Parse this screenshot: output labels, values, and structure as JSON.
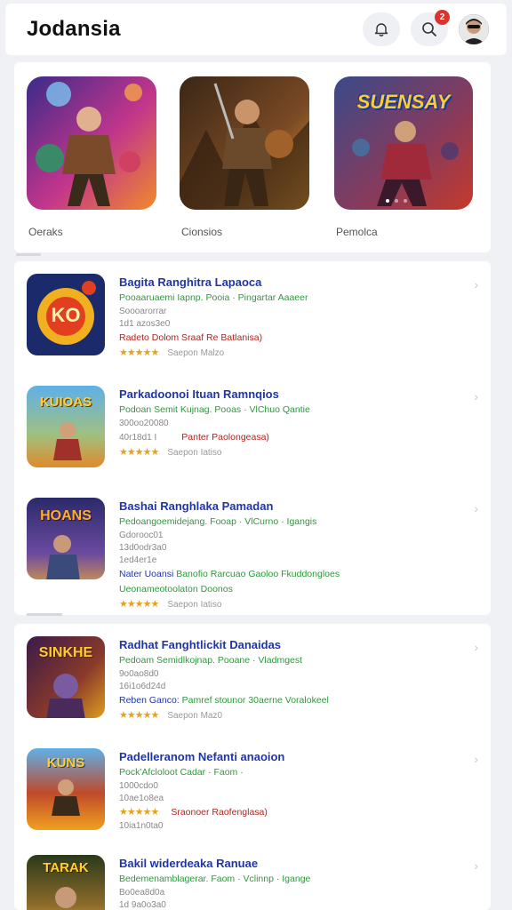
{
  "header": {
    "title": "Jodansia",
    "notification_icon": "bell-icon",
    "search_icon": "search-icon",
    "search_badge": "2"
  },
  "featured": [
    {
      "label": "Oeraks",
      "colors": [
        "#3b2a8a",
        "#c2358c",
        "#f08a2a"
      ]
    },
    {
      "label": "Cionsios",
      "colors": [
        "#3a2616",
        "#7a4a24",
        "#e09a3a"
      ]
    },
    {
      "label": "Pemolca",
      "colors": [
        "#3a4a8a",
        "#8a3a5a",
        "#c63a2a"
      ],
      "banner": "SUENSAY"
    }
  ],
  "list": [
    {
      "title": "Bagita Ranghitra Lapaoca",
      "sub": "Pooaaruaemi Iapnp. Pooia · Pingartar Aaaeer",
      "meta1": "Soooarorrar",
      "meta2": "1d1 azos3e0",
      "tag": "Radeto Dolom Sraaf Re Batlanisa)",
      "stars": "★★★★★",
      "count": "Saepon Malzo",
      "icon_text": "KO",
      "icon_colors": [
        "#1a2a6a",
        "#f0b020",
        "#e04020"
      ]
    },
    {
      "title": "Parkadoonoi Ituan Ramnqios",
      "sub": "Podoan Semit Kujnag. Pooas · VlChuo Qantie",
      "meta1": "300oo20080",
      "meta2": "40r18d1 I",
      "tag": "Panter Paolongeasa)",
      "stars": "★★★★★",
      "count": "Saepon Iatiso",
      "icon_text": "KUIOAS",
      "icon_colors": [
        "#5fb0e8",
        "#3a8a3a",
        "#e08a2a"
      ]
    },
    {
      "title": "Bashai Ranghlaka Pamadan",
      "sub": "Pedoangoemidejang. Fooap · VlCurno · Igangis",
      "meta1": "Gdorooc01",
      "meta2": "13d0odr3a0",
      "meta3": "1ed4er1e",
      "tag_a": "Nater Uoansi ",
      "tag_b": "Banofio Rarcuao Gaoloo Fkuddongloes",
      "tag_c": "Ueonameotoolaton Doonos",
      "stars": "★★★★★",
      "count": "Saepon Iatiso",
      "icon_text": "HOANS",
      "icon_colors": [
        "#2a2a6a",
        "#6a4aa0",
        "#e0a040"
      ]
    },
    {
      "title": "Radhat Fanghtlickit Danaidas",
      "sub": "Pedoam Semidlkojnap. Pooane · Vladmgest",
      "meta1": "9o0ao8d0",
      "meta2": "16i1o6d24d",
      "tag_a": "Reben Ganco: ",
      "tag_b": "Pamref stounor 30aerne Voralokeel",
      "stars": "★★★★★",
      "count": "Saepon Maz0",
      "icon_text": "SINKHE",
      "icon_colors": [
        "#3a1a4a",
        "#8a3a2a",
        "#e0a020"
      ]
    },
    {
      "title": "Padelleranom Nefanti anaoion",
      "sub": "Pock'Afcloloot Cadar · Faom ·",
      "meta1": "1000cdo0",
      "meta2": "10ae1o8ea",
      "meta3": "10ia1n0ta0",
      "tag": "Sraonoer Raofenglasa)",
      "stars": "★★★★★",
      "count": "Saepon Iatiso",
      "icon_text": "KUNS",
      "icon_colors": [
        "#5fb0e8",
        "#c04a2a",
        "#f0a020"
      ]
    },
    {
      "title": "Bakil widerdeaka Ranuae",
      "sub": "Bedemenamblagerar. Faom · Vclinnp · Igange",
      "meta1": "Bo0ea8d0a",
      "meta2": "1d 9a0o3a0",
      "icon_text": "TARAK",
      "icon_colors": [
        "#2a3a1a",
        "#8a6a2a",
        "#e0b040"
      ]
    }
  ]
}
